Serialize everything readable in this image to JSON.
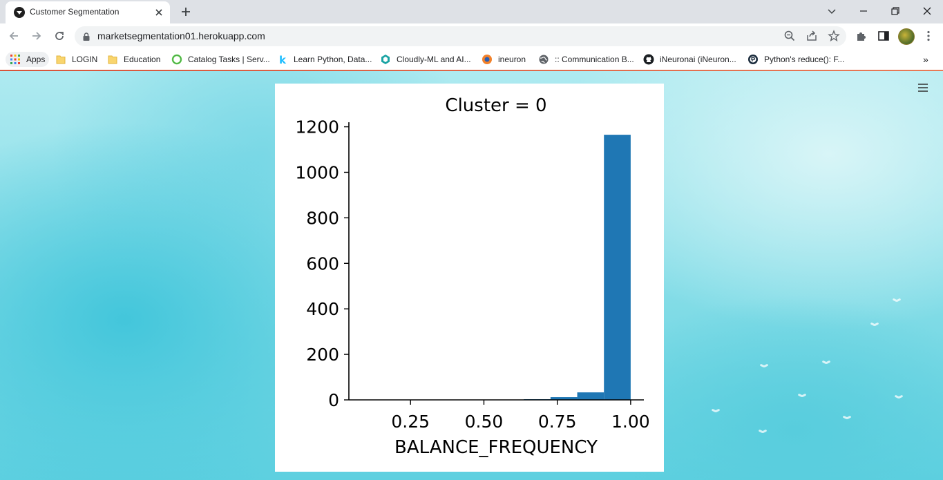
{
  "browser": {
    "tab": {
      "title": "Customer Segmentation"
    },
    "address": {
      "url": "marketsegmentation01.herokuapp.com"
    },
    "bookmarks": [
      {
        "label": "Apps",
        "icon": "apps-grid-icon"
      },
      {
        "label": "LOGIN",
        "icon": "folder-icon"
      },
      {
        "label": "Education",
        "icon": "folder-icon"
      },
      {
        "label": "Catalog Tasks | Serv...",
        "icon": "servicenow-icon"
      },
      {
        "label": "Learn Python, Data...",
        "icon": "kaggle-icon"
      },
      {
        "label": "Cloudly-ML and AI...",
        "icon": "cloudly-icon"
      },
      {
        "label": "ineuron",
        "icon": "ineuron-icon"
      },
      {
        "label": ":: Communication B...",
        "icon": "globe-icon"
      },
      {
        "label": "iNeuronai (iNeuron...",
        "icon": "github-icon"
      },
      {
        "label": "Python's reduce(): F...",
        "icon": "realpython-icon"
      }
    ],
    "overflow_label": "»"
  },
  "colors": {
    "bar": "#1f77b4",
    "accent_loadbar": "#d8543a"
  },
  "chart_data": {
    "type": "bar",
    "title": "Cluster = 0",
    "xlabel": "BALANCE_FREQUENCY",
    "ylabel": "",
    "xlim": [
      0.04,
      1.045
    ],
    "ylim": [
      0,
      1220
    ],
    "xticks": [
      {
        "value": 0.25,
        "label": "0.25"
      },
      {
        "value": 0.5,
        "label": "0.50"
      },
      {
        "value": 0.75,
        "label": "0.75"
      },
      {
        "value": 1.0,
        "label": "1.00"
      }
    ],
    "yticks": [
      {
        "value": 0,
        "label": "0"
      },
      {
        "value": 200,
        "label": "200"
      },
      {
        "value": 400,
        "label": "400"
      },
      {
        "value": 600,
        "label": "600"
      },
      {
        "value": 800,
        "label": "800"
      },
      {
        "value": 1000,
        "label": "1000"
      },
      {
        "value": 1200,
        "label": "1200"
      }
    ],
    "bins": [
      {
        "x0": 0.636,
        "x1": 0.727,
        "count": 3
      },
      {
        "x0": 0.727,
        "x1": 0.818,
        "count": 12
      },
      {
        "x0": 0.818,
        "x1": 0.909,
        "count": 33
      },
      {
        "x0": 0.909,
        "x1": 1.0,
        "count": 1165
      }
    ],
    "grid": false,
    "legend": "none"
  }
}
